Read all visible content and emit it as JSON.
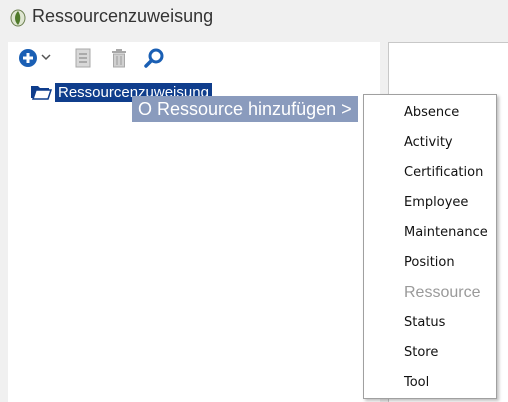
{
  "window": {
    "title": "Ressourcenzuweisung",
    "icon": "app-leaf-icon"
  },
  "toolbar": {
    "icons": [
      "add-circle-icon",
      "chevron-down-icon",
      "document-icon",
      "trash-icon",
      "search-icon"
    ]
  },
  "tree": {
    "selected_node": "Ressourcenzuweisung",
    "node_icon": "folder-open-icon"
  },
  "drag_indicator": {
    "text": "O Ressource hinzufügen >"
  },
  "context_menu": {
    "items": [
      {
        "label": "Absence",
        "enabled": true
      },
      {
        "label": "Activity",
        "enabled": true
      },
      {
        "label": "Certification",
        "enabled": true
      },
      {
        "label": "Employee",
        "enabled": true
      },
      {
        "label": "Maintenance",
        "enabled": true
      },
      {
        "label": "Position",
        "enabled": true
      },
      {
        "label": "Ressource",
        "enabled": false
      },
      {
        "label": "Status",
        "enabled": true
      },
      {
        "label": "Store",
        "enabled": true
      },
      {
        "label": "Tool",
        "enabled": true
      }
    ]
  },
  "colors": {
    "selection": "#0f3d8c",
    "accent": "#1a5fb4",
    "drag_bg": "#8a9bbd"
  }
}
